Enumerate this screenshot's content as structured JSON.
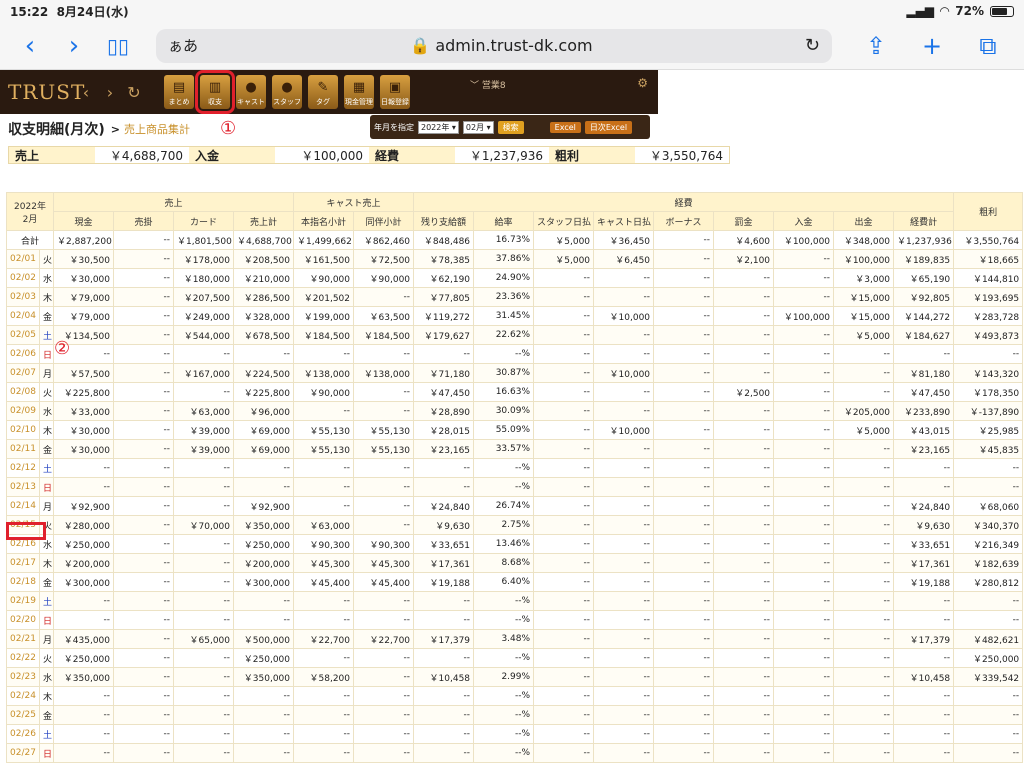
{
  "status": {
    "time": "15:22",
    "date": "8月24日(水)",
    "battery": "72%"
  },
  "browser": {
    "aa": "ぁあ",
    "url": "admin.trust-dk.com"
  },
  "app": {
    "logo": "TRUST",
    "icons": [
      "まとめ",
      "収支",
      "キャスト",
      "スタッフ",
      "タグ",
      "現金管理",
      "日報登録"
    ],
    "sales_label": "営業8"
  },
  "title": {
    "page": "収支明細(月次)",
    "sep": ">",
    "crumb": "売上商品集計",
    "ann1": "①",
    "ann2": "②"
  },
  "filter": {
    "label": "年月を指定",
    "year": "2022年",
    "month": "02月",
    "search": "検索",
    "excel": "Excel",
    "daily_excel": "日次Excel"
  },
  "summary": [
    {
      "label": "売上",
      "value": "￥4,688,700"
    },
    {
      "label": "入金",
      "value": "￥100,000"
    },
    {
      "label": "経費",
      "value": "￥1,237,936"
    },
    {
      "label": "粗利",
      "value": "￥3,550,764"
    }
  ],
  "table": {
    "corner": [
      "2022年",
      "2月"
    ],
    "groups": {
      "sales": "売上",
      "cast": "キャスト売上",
      "expense": "経費",
      "profit": "粗利"
    },
    "columns": [
      "現金",
      "売掛",
      "カード",
      "売上計",
      "本指名小計",
      "同伴小計",
      "残り支給額",
      "給率",
      "スタッフ日払",
      "キャスト日払",
      "ボーナス",
      "罰金",
      "入金",
      "出金",
      "経費計"
    ],
    "total": [
      "合計",
      "￥2,887,200",
      "--",
      "￥1,801,500",
      "￥4,688,700",
      "￥1,499,662",
      "￥862,460",
      "￥848,486",
      "16.73%",
      "￥5,000",
      "￥36,450",
      "--",
      "￥4,600",
      "￥100,000",
      "￥348,000",
      "￥1,237,936",
      "￥3,550,764"
    ],
    "rows": [
      [
        "02/01",
        "火",
        "￥30,500",
        "--",
        "￥178,000",
        "￥208,500",
        "￥161,500",
        "￥72,500",
        "￥78,385",
        "37.86%",
        "￥5,000",
        "￥6,450",
        "--",
        "￥2,100",
        "--",
        "￥100,000",
        "￥189,835",
        "￥18,665"
      ],
      [
        "02/02",
        "水",
        "￥30,000",
        "--",
        "￥180,000",
        "￥210,000",
        "￥90,000",
        "￥90,000",
        "￥62,190",
        "24.90%",
        "--",
        "--",
        "--",
        "--",
        "--",
        "￥3,000",
        "￥65,190",
        "￥144,810"
      ],
      [
        "02/03",
        "木",
        "￥79,000",
        "--",
        "￥207,500",
        "￥286,500",
        "￥201,502",
        "--",
        "￥77,805",
        "23.36%",
        "--",
        "--",
        "--",
        "--",
        "--",
        "￥15,000",
        "￥92,805",
        "￥193,695"
      ],
      [
        "02/04",
        "金",
        "￥79,000",
        "--",
        "￥249,000",
        "￥328,000",
        "￥199,000",
        "￥63,500",
        "￥119,272",
        "31.45%",
        "--",
        "￥10,000",
        "--",
        "--",
        "￥100,000",
        "￥15,000",
        "￥144,272",
        "￥283,728"
      ],
      [
        "02/05",
        "土",
        "￥134,500",
        "--",
        "￥544,000",
        "￥678,500",
        "￥184,500",
        "￥184,500",
        "￥179,627",
        "22.62%",
        "--",
        "--",
        "--",
        "--",
        "--",
        "￥5,000",
        "￥184,627",
        "￥493,873"
      ],
      [
        "02/06",
        "日",
        "--",
        "--",
        "--",
        "--",
        "--",
        "--",
        "--",
        "--%",
        "--",
        "--",
        "--",
        "--",
        "--",
        "--",
        "--",
        "--"
      ],
      [
        "02/07",
        "月",
        "￥57,500",
        "--",
        "￥167,000",
        "￥224,500",
        "￥138,000",
        "￥138,000",
        "￥71,180",
        "30.87%",
        "--",
        "￥10,000",
        "--",
        "--",
        "--",
        "--",
        "￥81,180",
        "￥143,320"
      ],
      [
        "02/08",
        "火",
        "￥225,800",
        "--",
        "--",
        "￥225,800",
        "￥90,000",
        "--",
        "￥47,450",
        "16.63%",
        "--",
        "--",
        "--",
        "￥2,500",
        "--",
        "--",
        "￥47,450",
        "￥178,350"
      ],
      [
        "02/09",
        "水",
        "￥33,000",
        "--",
        "￥63,000",
        "￥96,000",
        "--",
        "--",
        "￥28,890",
        "30.09%",
        "--",
        "--",
        "--",
        "--",
        "--",
        "￥205,000",
        "￥233,890",
        "￥-137,890"
      ],
      [
        "02/10",
        "木",
        "￥30,000",
        "--",
        "￥39,000",
        "￥69,000",
        "￥55,130",
        "￥55,130",
        "￥28,015",
        "55.09%",
        "--",
        "￥10,000",
        "--",
        "--",
        "--",
        "￥5,000",
        "￥43,015",
        "￥25,985"
      ],
      [
        "02/11",
        "金",
        "￥30,000",
        "--",
        "￥39,000",
        "￥69,000",
        "￥55,130",
        "￥55,130",
        "￥23,165",
        "33.57%",
        "--",
        "--",
        "--",
        "--",
        "--",
        "--",
        "￥23,165",
        "￥45,835"
      ],
      [
        "02/12",
        "土",
        "--",
        "--",
        "--",
        "--",
        "--",
        "--",
        "--",
        "--%",
        "--",
        "--",
        "--",
        "--",
        "--",
        "--",
        "--",
        "--"
      ],
      [
        "02/13",
        "日",
        "--",
        "--",
        "--",
        "--",
        "--",
        "--",
        "--",
        "--%",
        "--",
        "--",
        "--",
        "--",
        "--",
        "--",
        "--",
        "--"
      ],
      [
        "02/14",
        "月",
        "￥92,900",
        "--",
        "--",
        "￥92,900",
        "--",
        "--",
        "￥24,840",
        "26.74%",
        "--",
        "--",
        "--",
        "--",
        "--",
        "--",
        "￥24,840",
        "￥68,060"
      ],
      [
        "02/15",
        "火",
        "￥280,000",
        "--",
        "￥70,000",
        "￥350,000",
        "￥63,000",
        "--",
        "￥9,630",
        "2.75%",
        "--",
        "--",
        "--",
        "--",
        "--",
        "--",
        "￥9,630",
        "￥340,370"
      ],
      [
        "02/16",
        "水",
        "￥250,000",
        "--",
        "--",
        "￥250,000",
        "￥90,300",
        "￥90,300",
        "￥33,651",
        "13.46%",
        "--",
        "--",
        "--",
        "--",
        "--",
        "--",
        "￥33,651",
        "￥216,349"
      ],
      [
        "02/17",
        "木",
        "￥200,000",
        "--",
        "--",
        "￥200,000",
        "￥45,300",
        "￥45,300",
        "￥17,361",
        "8.68%",
        "--",
        "--",
        "--",
        "--",
        "--",
        "--",
        "￥17,361",
        "￥182,639"
      ],
      [
        "02/18",
        "金",
        "￥300,000",
        "--",
        "--",
        "￥300,000",
        "￥45,400",
        "￥45,400",
        "￥19,188",
        "6.40%",
        "--",
        "--",
        "--",
        "--",
        "--",
        "--",
        "￥19,188",
        "￥280,812"
      ],
      [
        "02/19",
        "土",
        "--",
        "--",
        "--",
        "--",
        "--",
        "--",
        "--",
        "--%",
        "--",
        "--",
        "--",
        "--",
        "--",
        "--",
        "--",
        "--"
      ],
      [
        "02/20",
        "日",
        "--",
        "--",
        "--",
        "--",
        "--",
        "--",
        "--",
        "--%",
        "--",
        "--",
        "--",
        "--",
        "--",
        "--",
        "--",
        "--"
      ],
      [
        "02/21",
        "月",
        "￥435,000",
        "--",
        "￥65,000",
        "￥500,000",
        "￥22,700",
        "￥22,700",
        "￥17,379",
        "3.48%",
        "--",
        "--",
        "--",
        "--",
        "--",
        "--",
        "￥17,379",
        "￥482,621"
      ],
      [
        "02/22",
        "火",
        "￥250,000",
        "--",
        "--",
        "￥250,000",
        "--",
        "--",
        "--",
        "--%",
        "--",
        "--",
        "--",
        "--",
        "--",
        "--",
        "--",
        "￥250,000"
      ],
      [
        "02/23",
        "水",
        "￥350,000",
        "--",
        "--",
        "￥350,000",
        "￥58,200",
        "--",
        "￥10,458",
        "2.99%",
        "--",
        "--",
        "--",
        "--",
        "--",
        "--",
        "￥10,458",
        "￥339,542"
      ],
      [
        "02/24",
        "木",
        "--",
        "--",
        "--",
        "--",
        "--",
        "--",
        "--",
        "--%",
        "--",
        "--",
        "--",
        "--",
        "--",
        "--",
        "--",
        "--"
      ],
      [
        "02/25",
        "金",
        "--",
        "--",
        "--",
        "--",
        "--",
        "--",
        "--",
        "--%",
        "--",
        "--",
        "--",
        "--",
        "--",
        "--",
        "--",
        "--"
      ],
      [
        "02/26",
        "土",
        "--",
        "--",
        "--",
        "--",
        "--",
        "--",
        "--",
        "--%",
        "--",
        "--",
        "--",
        "--",
        "--",
        "--",
        "--",
        "--"
      ],
      [
        "02/27",
        "日",
        "--",
        "--",
        "--",
        "--",
        "--",
        "--",
        "--",
        "--%",
        "--",
        "--",
        "--",
        "--",
        "--",
        "--",
        "--",
        "--"
      ]
    ]
  }
}
